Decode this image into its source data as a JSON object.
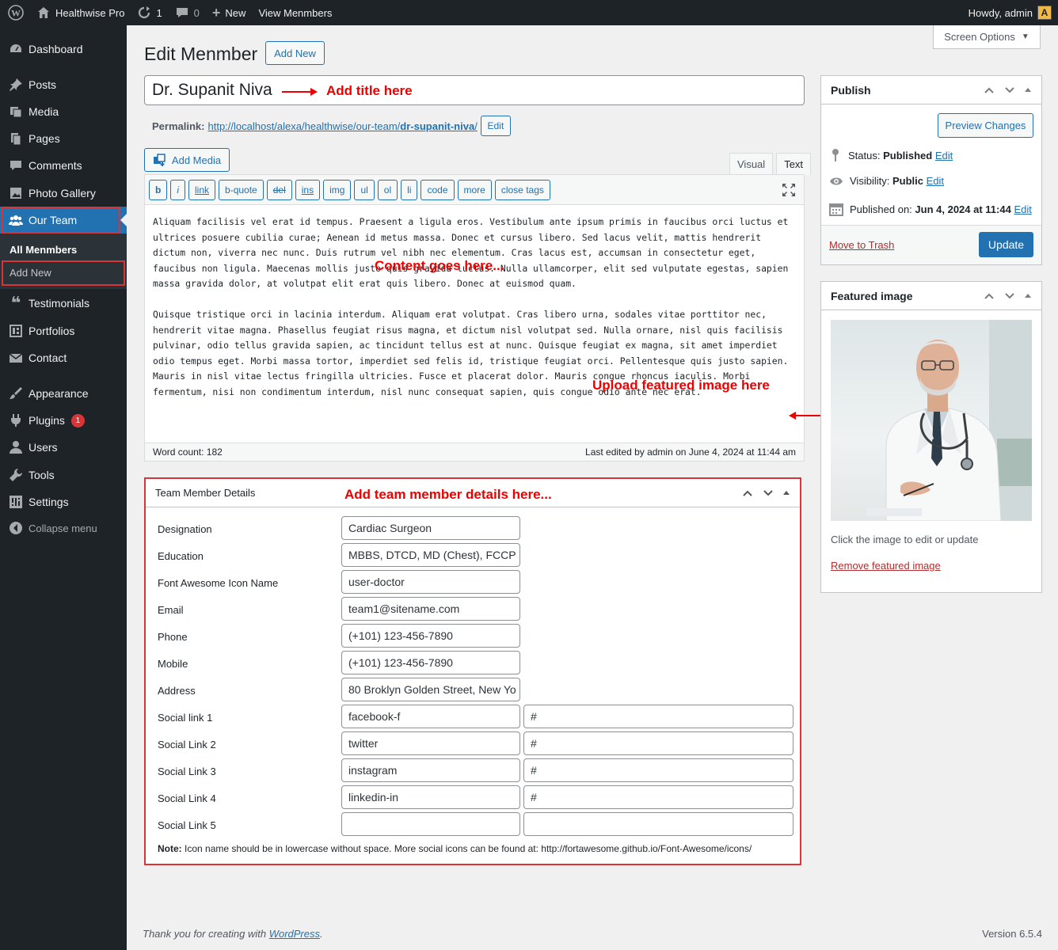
{
  "adminbar": {
    "site_name": "Healthwise Pro",
    "updates_count": "1",
    "comments_count": "0",
    "new_label": "New",
    "view_label": "View Menmbers",
    "howdy": "Howdy, admin"
  },
  "sidebar": {
    "items": [
      {
        "label": "Dashboard"
      },
      {
        "label": "Posts"
      },
      {
        "label": "Media"
      },
      {
        "label": "Pages"
      },
      {
        "label": "Comments"
      },
      {
        "label": "Photo Gallery"
      },
      {
        "label": "Our Team"
      },
      {
        "label": "Testimonials"
      },
      {
        "label": "Portfolios"
      },
      {
        "label": "Contact"
      },
      {
        "label": "Appearance"
      },
      {
        "label": "Plugins"
      },
      {
        "label": "Users"
      },
      {
        "label": "Tools"
      },
      {
        "label": "Settings"
      },
      {
        "label": "Collapse menu"
      }
    ],
    "submenu": {
      "all": "All Menmbers",
      "add_new": "Add New"
    },
    "plugins_badge": "1"
  },
  "screen_options": "Screen Options",
  "page": {
    "title": "Edit Menmber",
    "add_new": "Add New",
    "post_title": "Dr. Supanit Niva",
    "permalink_label": "Permalink:",
    "permalink_base": "http://localhost/alexa/healthwise/our-team/",
    "permalink_slug": "dr-supanit-niva",
    "permalink_trailing": "/",
    "permalink_edit": "Edit"
  },
  "annotations": {
    "title": "Add title here",
    "content": "Content goes here...",
    "featured": "Upload featured image here",
    "details": "Add team member details here..."
  },
  "editor": {
    "add_media": "Add Media",
    "tab_visual": "Visual",
    "tab_text": "Text",
    "toolbar": [
      "b",
      "i",
      "link",
      "b-quote",
      "del",
      "ins",
      "img",
      "ul",
      "ol",
      "li",
      "code",
      "more",
      "close tags"
    ],
    "paragraphs": [
      "Aliquam facilisis vel erat id tempus. Praesent a ligula eros. Vestibulum ante ipsum primis in faucibus orci luctus et ultrices posuere cubilia curae; Aenean id metus massa. Donec et cursus libero. Sed lacus velit, mattis hendrerit dictum non, viverra nec nunc. Duis rutrum vel nibh nec elementum. Cras lacus est, accumsan in consectetur eget, faucibus non ligula. Maecenas mollis justo quis gravida luctus. Nulla ullamcorper, elit sed vulputate egestas, sapien massa gravida dolor, at volutpat elit erat quis libero. Donec at euismod quam.",
      "Quisque tristique orci in lacinia interdum. Aliquam erat volutpat. Cras libero urna, sodales vitae porttitor nec, hendrerit vitae magna. Phasellus feugiat risus magna, et dictum nisl volutpat sed. Nulla ornare, nisl quis facilisis pulvinar, odio tellus gravida sapien, ac tincidunt tellus est at nunc. Quisque feugiat ex magna, sit amet imperdiet odio tempus eget. Morbi massa tortor, imperdiet sed felis id, tristique feugiat orci. Pellentesque quis justo sapien. Mauris in nisl vitae lectus fringilla ultricies. Fusce et placerat dolor. Mauris congue rhoncus iaculis. Morbi fermentum, nisi non condimentum interdum, nisl nunc consequat sapien, quis congue odio ante nec erat."
    ],
    "word_count": "Word count: 182",
    "last_edited": "Last edited by admin on June 4, 2024 at 11:44 am"
  },
  "team_details": {
    "title": "Team Member Details",
    "fields": [
      {
        "label": "Designation",
        "value": "Cardiac Surgeon"
      },
      {
        "label": "Education",
        "value": "MBBS, DTCD, MD (Chest), FCCP (A"
      },
      {
        "label": "Font Awesome Icon Name",
        "value": "user-doctor"
      },
      {
        "label": "Email",
        "value": "team1@sitename.com"
      },
      {
        "label": "Phone",
        "value": "(+101) 123-456-7890"
      },
      {
        "label": "Mobile",
        "value": "(+101) 123-456-7890"
      },
      {
        "label": "Address",
        "value": "80 Broklyn Golden Street, New Yo"
      }
    ],
    "social": [
      {
        "label": "Social link 1",
        "icon": "facebook-f",
        "url": "#"
      },
      {
        "label": "Social Link 2",
        "icon": "twitter",
        "url": "#"
      },
      {
        "label": "Social Link 3",
        "icon": "instagram",
        "url": "#"
      },
      {
        "label": "Social Link 4",
        "icon": "linkedin-in",
        "url": "#"
      },
      {
        "label": "Social Link 5",
        "icon": "",
        "url": ""
      }
    ],
    "note_bold": "Note:",
    "note_text": " Icon name should be in lowercase without space. More social icons can be found at: http://fortawesome.github.io/Font-Awesome/icons/"
  },
  "publish": {
    "title": "Publish",
    "preview": "Preview Changes",
    "status_label": "Status:",
    "status_value": "Published",
    "visibility_label": "Visibility:",
    "visibility_value": "Public",
    "published_label": "Published on:",
    "published_value": "Jun 4, 2024 at 11:44",
    "edit": "Edit",
    "trash": "Move to Trash",
    "update": "Update"
  },
  "featured": {
    "title": "Featured image",
    "hint": "Click the image to edit or update",
    "remove": "Remove featured image"
  },
  "footer": {
    "thanks_prefix": "Thank you for creating with ",
    "wordpress": "WordPress",
    "thanks_suffix": ".",
    "version": "Version 6.5.4"
  },
  "colors": {
    "accent": "#2271b1",
    "sidebar_bg": "#1d2327",
    "annotation": "#e00000",
    "highlight_border": "#d63638"
  }
}
